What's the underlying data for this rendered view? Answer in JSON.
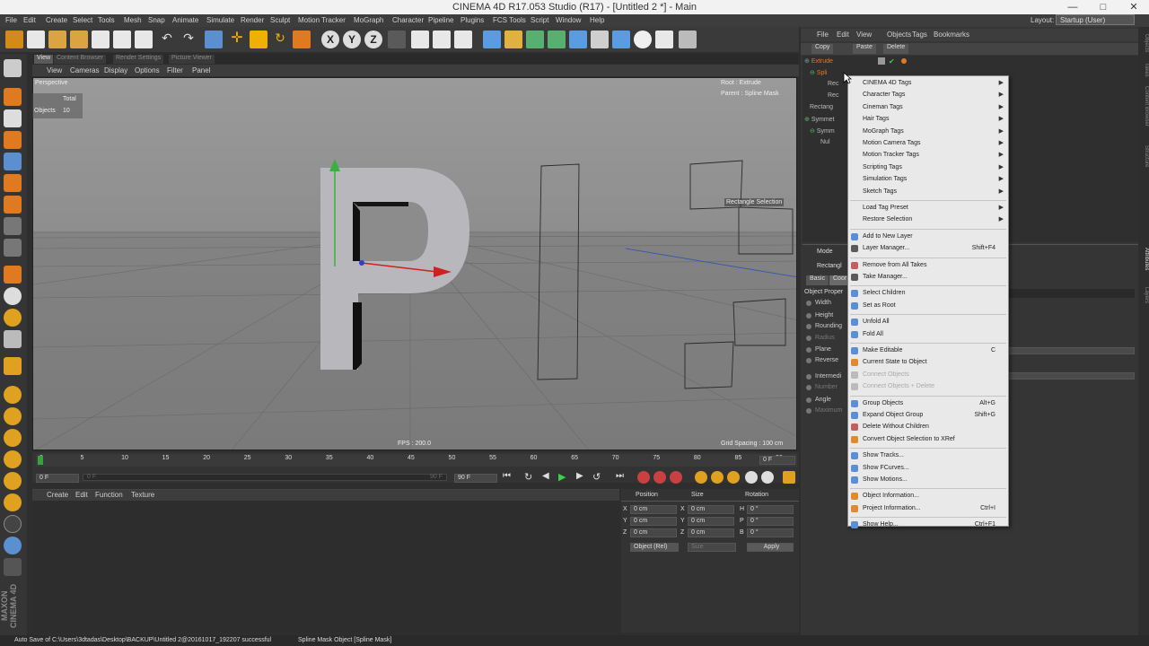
{
  "window": {
    "title": "CINEMA 4D R17.053 Studio (R17) - [Untitled 2 *] - Main",
    "layout_label": "Layout:",
    "layout_value": "Startup (User)",
    "min": "—",
    "max": "□",
    "close": "✕"
  },
  "menubar": [
    "File",
    "Edit",
    "Create",
    "Select",
    "Tools",
    "Mesh",
    "Snap",
    "Animate",
    "Simulate",
    "Render",
    "Sculpt",
    "Motion Tracker",
    "MoGraph",
    "Character",
    "Pipeline",
    "Plugins",
    "FCS Tools",
    "Script",
    "Window",
    "Help"
  ],
  "axis_buttons": [
    "X",
    "Y",
    "Z"
  ],
  "viewport_tabs": [
    "View",
    "Content Browser",
    "Render Settings",
    "Picture Viewer"
  ],
  "viewport_menu": [
    "View",
    "Cameras",
    "Display",
    "Options",
    "Filter",
    "Panel"
  ],
  "viewport": {
    "name": "Perspective",
    "hud_total_label": "Total",
    "hud_objects_label": "Objects",
    "hud_objects_value": "10",
    "root_info": "Root : Extrude",
    "parent_info": "Parent : Spline Mask",
    "selection_label": "Rectangle Selection",
    "fps": "FPS : 200.0",
    "grid_spacing": "Grid Spacing : 100 cm"
  },
  "timeline": {
    "ticks": [
      "0",
      "5",
      "10",
      "15",
      "20",
      "25",
      "30",
      "35",
      "40",
      "45",
      "50",
      "55",
      "60",
      "65",
      "70",
      "75",
      "80",
      "85",
      "90"
    ],
    "end_field": "0 F",
    "start_field": "0 F",
    "slider_start": "0 F",
    "slider_end": "90 F",
    "max_field": "90 F"
  },
  "manager_menu": [
    "Create",
    "Edit",
    "Function",
    "Texture"
  ],
  "coord": {
    "headers": [
      "Position",
      "Size",
      "Rotation"
    ],
    "rows": [
      {
        "axis": "X",
        "pos": "0 cm",
        "saxis": "X",
        "size": "0 cm",
        "raxis": "H",
        "rot": "0 °"
      },
      {
        "axis": "Y",
        "pos": "0 cm",
        "saxis": "Y",
        "size": "0 cm",
        "raxis": "P",
        "rot": "0 °"
      },
      {
        "axis": "Z",
        "pos": "0 cm",
        "saxis": "Z",
        "size": "0 cm",
        "raxis": "B",
        "rot": "0 °"
      }
    ],
    "mode": "Object (Rel)",
    "size_mode": "Size",
    "apply": "Apply"
  },
  "right_menu": [
    "File",
    "Edit",
    "View",
    "Objects",
    "Tags",
    "Bookmarks"
  ],
  "right_bar": [
    "Copy",
    "Paste",
    "Delete"
  ],
  "objects": [
    "Extrude",
    "Spli",
    "Rec",
    "Rec",
    "Rectang",
    "Symmet",
    "Symm",
    "Nul"
  ],
  "attr": {
    "mode": "Mode",
    "object_label": "Rectangl",
    "tabs": [
      "Basic",
      "Coor"
    ],
    "section": "Object Proper",
    "props": [
      "Width",
      "Height",
      "Rounding",
      "Radius",
      "Plane",
      "Reverse",
      "Intermedi",
      "Number",
      "Angle",
      "Maximum"
    ]
  },
  "side_tabs": [
    "Objects",
    "Takes",
    "Content Browser",
    "Structure",
    "Attributes",
    "Layers"
  ],
  "context_menu": [
    {
      "label": "CINEMA 4D Tags",
      "arrow": true
    },
    {
      "label": "Character Tags",
      "arrow": true
    },
    {
      "label": "Cineman Tags",
      "arrow": true
    },
    {
      "label": "Hair Tags",
      "arrow": true
    },
    {
      "label": "MoGraph Tags",
      "arrow": true
    },
    {
      "label": "Motion Camera Tags",
      "arrow": true
    },
    {
      "label": "Motion Tracker Tags",
      "arrow": true
    },
    {
      "label": "Scripting Tags",
      "arrow": true
    },
    {
      "label": "Simulation Tags",
      "arrow": true
    },
    {
      "label": "Sketch Tags",
      "arrow": true
    },
    {
      "sep": true
    },
    {
      "label": "Load Tag Preset",
      "arrow": true
    },
    {
      "label": "Restore Selection",
      "arrow": true
    },
    {
      "sep": true
    },
    {
      "label": "Add to New Layer",
      "icon": "#5a8fd6"
    },
    {
      "label": "Layer Manager...",
      "shortcut": "Shift+F4",
      "icon": "#5a5a5a"
    },
    {
      "sep": true
    },
    {
      "label": "Remove from All Takes",
      "icon": "#c06060"
    },
    {
      "label": "Take Manager...",
      "icon": "#5a5a5a"
    },
    {
      "sep": true
    },
    {
      "label": "Select Children",
      "icon": "#5a8fd6"
    },
    {
      "label": "Set as Root",
      "icon": "#5a8fd6"
    },
    {
      "sep": true
    },
    {
      "label": "Unfold All",
      "icon": "#5a8fd6"
    },
    {
      "label": "Fold All",
      "icon": "#5a8fd6"
    },
    {
      "sep": true
    },
    {
      "label": "Make Editable",
      "shortcut": "C",
      "icon": "#5a8fd6"
    },
    {
      "label": "Current State to Object",
      "icon": "#e08a30"
    },
    {
      "label": "Connect Objects",
      "disabled": true,
      "icon": "#bbbbbb"
    },
    {
      "label": "Connect Objects + Delete",
      "disabled": true,
      "icon": "#bbbbbb"
    },
    {
      "sep": true
    },
    {
      "label": "Group Objects",
      "shortcut": "Alt+G",
      "icon": "#5a8fd6"
    },
    {
      "label": "Expand Object Group",
      "shortcut": "Shift+G",
      "icon": "#5a8fd6"
    },
    {
      "label": "Delete Without Children",
      "icon": "#c06060"
    },
    {
      "label": "Convert Object Selection to XRef",
      "icon": "#e08a30"
    },
    {
      "sep": true
    },
    {
      "label": "Show Tracks...",
      "icon": "#5a8fd6"
    },
    {
      "label": "Show FCurves...",
      "icon": "#5a8fd6"
    },
    {
      "label": "Show Motions...",
      "icon": "#5a8fd6"
    },
    {
      "sep": true
    },
    {
      "label": "Object Information...",
      "icon": "#e08a30"
    },
    {
      "label": "Project Information...",
      "shortcut": "Ctrl+I",
      "icon": "#e08a30"
    },
    {
      "sep": true
    },
    {
      "label": "Show Help...",
      "shortcut": "Ctrl+F1",
      "icon": "#5a8fd6"
    }
  ],
  "status": {
    "left": "Auto Save of C:\\Users\\3dtadas\\Desktop\\BACKUP\\Untitled 2@20161017_192207 successful",
    "right": "Spline Mask Object [Spline Mask]"
  },
  "colors": {
    "accent": "#f0a000",
    "tag_orange": "#e07a20",
    "menu_bg": "#e9e9e9"
  }
}
